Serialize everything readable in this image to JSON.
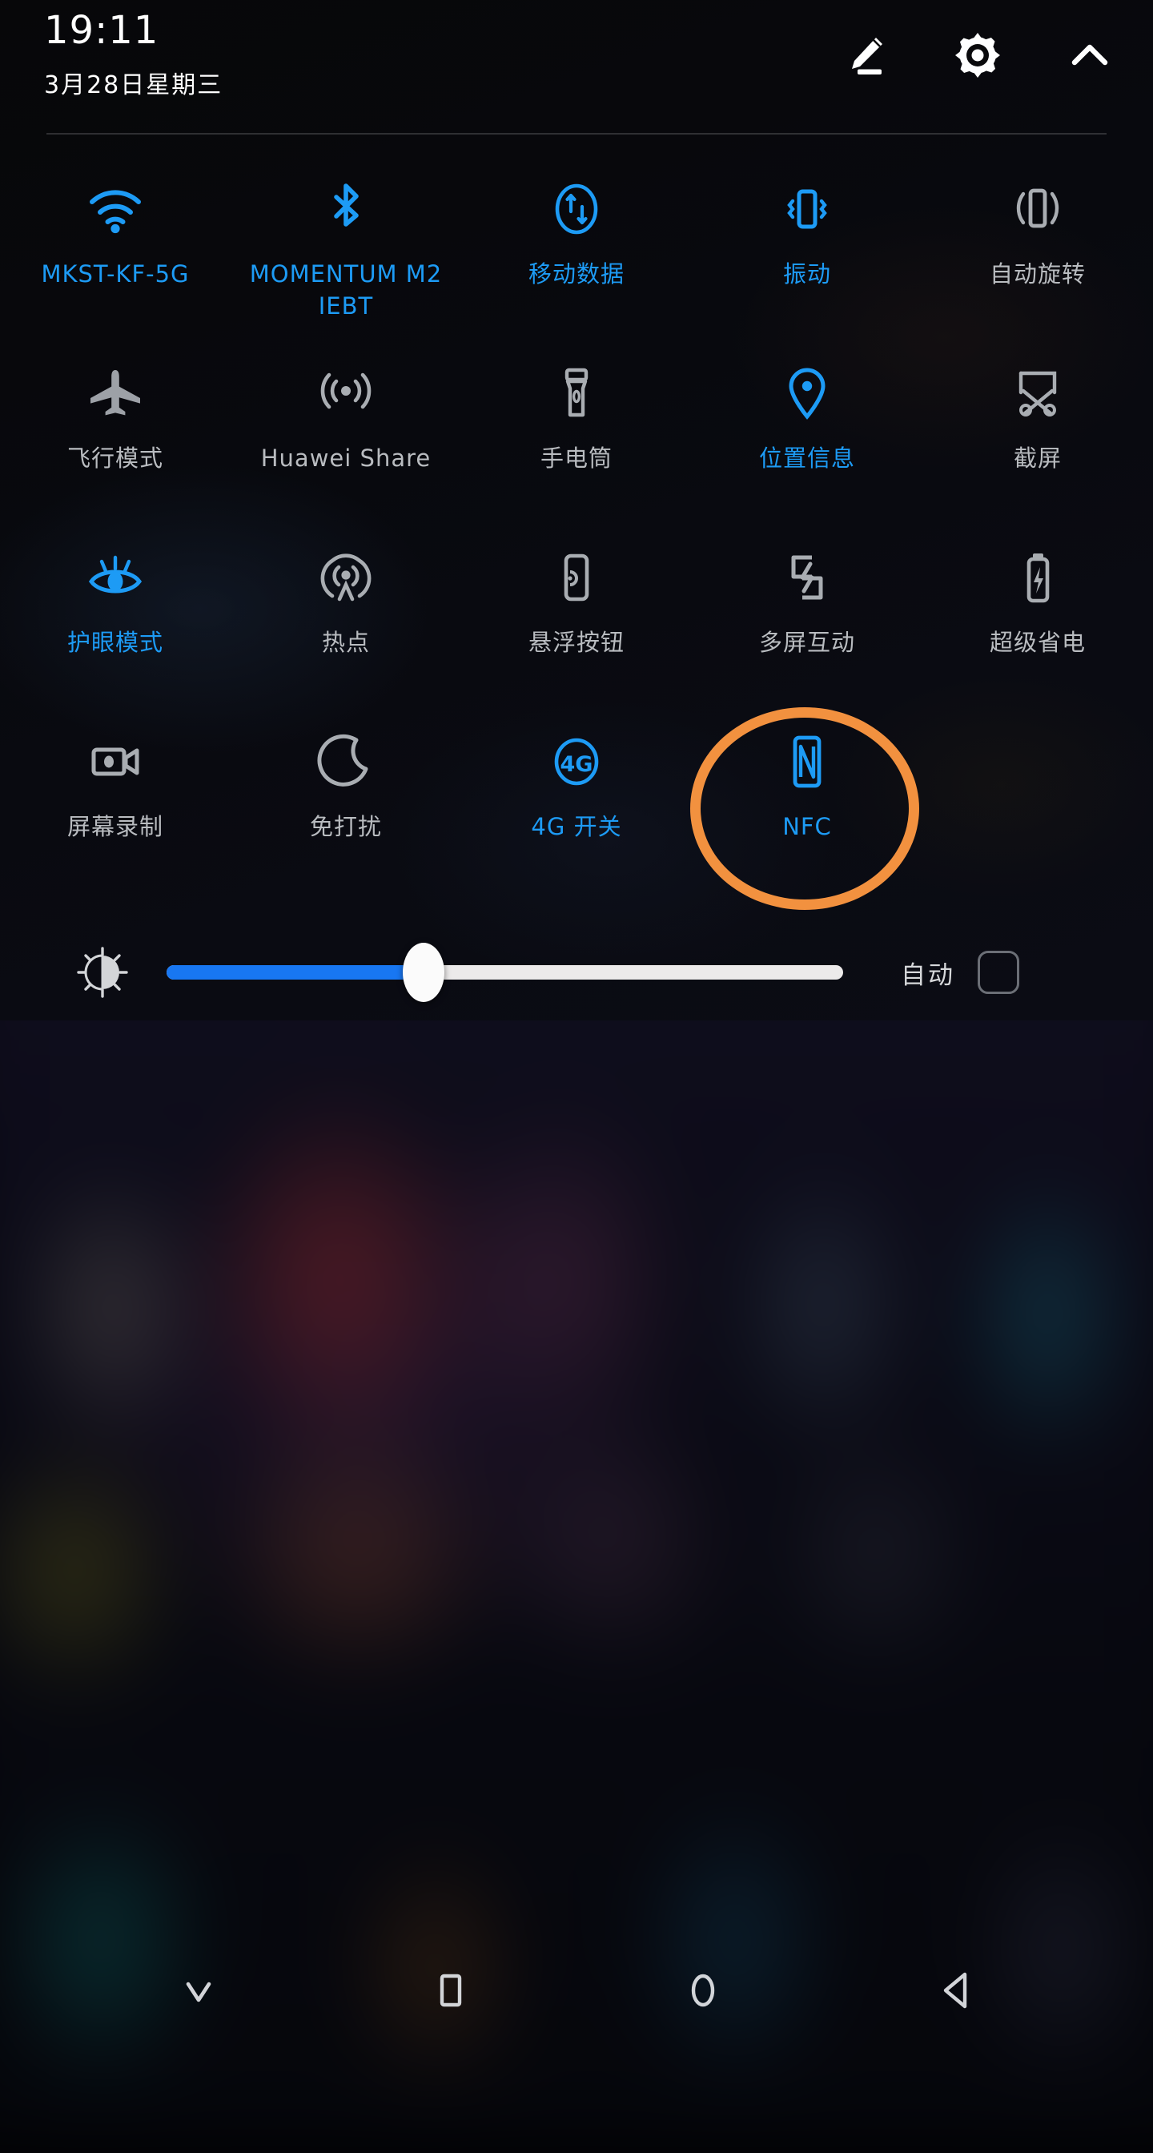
{
  "status": {
    "time": "19:11",
    "date": "3月28日星期三"
  },
  "header_icons": [
    {
      "name": "edit-icon",
      "label": "编辑"
    },
    {
      "name": "gear-icon",
      "label": "设置"
    },
    {
      "name": "chevron-up-icon",
      "label": "收起"
    }
  ],
  "tiles": [
    {
      "icon": "wifi-icon",
      "label": "MKST-KF-5G",
      "state": "on"
    },
    {
      "icon": "bluetooth-icon",
      "label": "MOMENTUM M2 IEBT",
      "state": "on"
    },
    {
      "icon": "mobile-data-icon",
      "label": "移动数据",
      "state": "on"
    },
    {
      "icon": "vibrate-icon",
      "label": "振动",
      "state": "on"
    },
    {
      "icon": "auto-rotate-icon",
      "label": "自动旋转",
      "state": "off"
    },
    {
      "icon": "airplane-icon",
      "label": "飞行模式",
      "state": "off"
    },
    {
      "icon": "huawei-share-icon",
      "label": "Huawei Share",
      "state": "off"
    },
    {
      "icon": "flashlight-icon",
      "label": "手电筒",
      "state": "off"
    },
    {
      "icon": "location-pin-icon",
      "label": "位置信息",
      "state": "on"
    },
    {
      "icon": "screenshot-icon",
      "label": "截屏",
      "state": "off"
    },
    {
      "icon": "eye-care-icon",
      "label": "护眼模式",
      "state": "on"
    },
    {
      "icon": "hotspot-icon",
      "label": "热点",
      "state": "off"
    },
    {
      "icon": "floating-button-icon",
      "label": "悬浮按钮",
      "state": "off"
    },
    {
      "icon": "multi-screen-icon",
      "label": "多屏互动",
      "state": "off"
    },
    {
      "icon": "super-saver-icon",
      "label": "超级省电",
      "state": "off"
    },
    {
      "icon": "screen-record-icon",
      "label": "屏幕录制",
      "state": "off"
    },
    {
      "icon": "do-not-disturb-icon",
      "label": "免打扰",
      "state": "off"
    },
    {
      "icon": "four-g-icon",
      "label": "4G 开关",
      "state": "on"
    },
    {
      "icon": "nfc-icon",
      "label": "NFC",
      "state": "on"
    },
    {
      "icon": "",
      "label": "",
      "state": "empty"
    }
  ],
  "brightness": {
    "icon": "brightness-icon",
    "value_percent": 38,
    "auto_label": "自动",
    "auto_checked": false
  },
  "navbar": [
    {
      "name": "collapse-icon",
      "label": "收起"
    },
    {
      "name": "recents-icon",
      "label": "最近任务"
    },
    {
      "name": "home-icon",
      "label": "主页"
    },
    {
      "name": "back-icon",
      "label": "返回"
    }
  ],
  "annotation": {
    "shape": "ellipse",
    "color": "#f2913f",
    "targets": "NFC"
  },
  "colors": {
    "accent_on": "#1d9bf5",
    "label_off": "#b9bcc0",
    "slider_fill": "#1877f2",
    "annotation": "#f2913f"
  }
}
